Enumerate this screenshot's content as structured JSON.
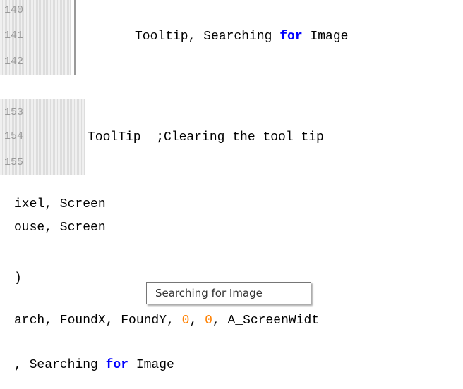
{
  "snippet1": {
    "line_numbers": [
      "140",
      "141",
      "142"
    ],
    "code_line": {
      "pre": "Tooltip, Searching ",
      "kw": "for",
      "post": " Image"
    }
  },
  "snippet2": {
    "line_numbers": [
      "153",
      "154",
      "155"
    ],
    "code_line": "ToolTip  ;Clearing the tool tip"
  },
  "snippet3": {
    "lines": [
      "ixel, Screen",
      "ouse, Screen"
    ],
    "paren": ")",
    "tooltip": "Searching for Image",
    "search_line": {
      "pre": "arch, FoundX, FoundY, ",
      "n1": "0",
      "sep": ", ",
      "n2": "0",
      "post": ", A_ScreenWidt"
    },
    "last_line": {
      "pre": ", Searching ",
      "kw": "for",
      "post": " Image"
    }
  },
  "colors": {
    "keyword": "#0000ff",
    "number": "#ff8000",
    "line_number": "#9a9a9a",
    "gutter": "#e4e4e4"
  }
}
